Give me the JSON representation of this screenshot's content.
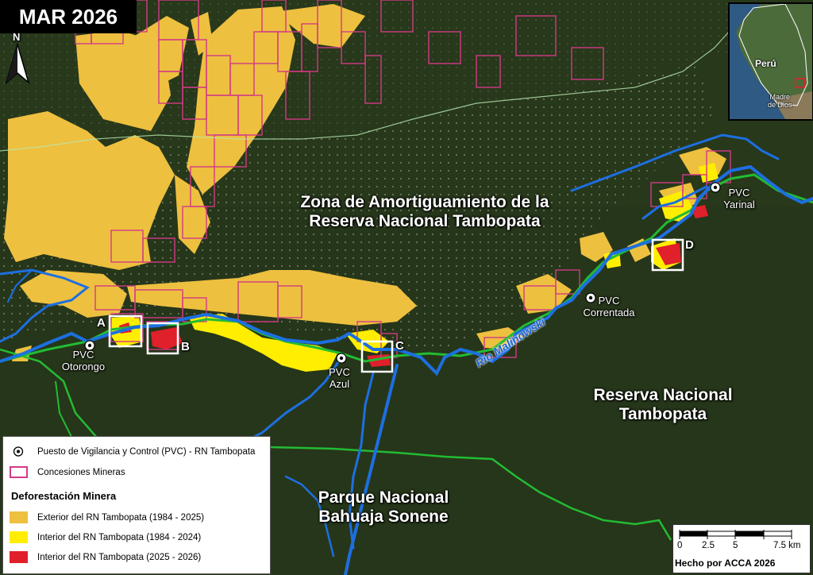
{
  "title": "MAR 2026",
  "north_label": "N",
  "colors": {
    "forest": "#26361a",
    "exterior_deforestation": "#eec03f",
    "interior_deforestation_1984_2024": "#ffee00",
    "interior_deforestation_2025_2026": "#e0202a",
    "mining_concessions": "#d23a86",
    "reserve_boundary": "#22bb33",
    "river": "#1d6fe0"
  },
  "icons": {
    "pvc_marker": "circle-dot-icon",
    "north_arrow": "north-arrow-icon"
  },
  "region_labels": {
    "buffer_zone": [
      "Zona de Amortiguamiento de la",
      "Reserva Nacional Tambopata"
    ],
    "reserve": [
      "Reserva Nacional",
      "Tambopata"
    ],
    "park": [
      "Parque Nacional",
      "Bahuaja Sonene"
    ]
  },
  "river_label": "Rio Malinowski",
  "pvc_stations": [
    {
      "lines": [
        "PVC",
        "Otorongo"
      ]
    },
    {
      "lines": [
        "PVC",
        "Azul"
      ]
    },
    {
      "lines": [
        "PVC",
        "Correntada"
      ]
    },
    {
      "lines": [
        "PVC",
        "Yarinal"
      ]
    }
  ],
  "box_labels": [
    "A",
    "B",
    "C",
    "D"
  ],
  "inset": {
    "country": "Perú",
    "region": [
      "Madre",
      "de Dios"
    ]
  },
  "legend": {
    "pvc": "Puesto de Vigilancia y Control (PVC) - RN Tambopata",
    "concessions": "Concesiones Mineras",
    "heading": "Deforestación Minera",
    "exterior": "Exterior del RN Tambopata (1984 - 2025)",
    "interior_old": "Interior del RN Tambopata (1984 - 2024)",
    "interior_new": "Interior del RN Tambopata (2025 - 2026)"
  },
  "scale_bar": {
    "ticks": [
      "0",
      "2.5",
      "5",
      "7.5 km"
    ]
  },
  "credit": "Hecho por ACCA 2026"
}
